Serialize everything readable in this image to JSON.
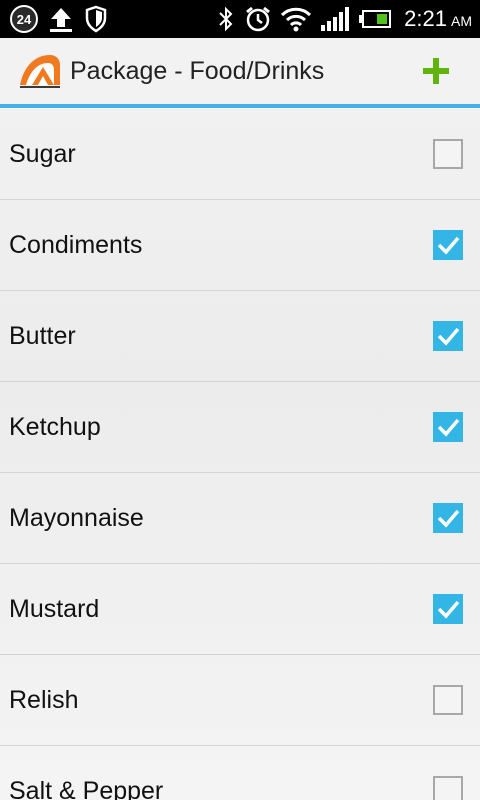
{
  "status_bar": {
    "notification_count": "24",
    "time": "2:21",
    "ampm": "AM",
    "icons": [
      "upload-icon",
      "shield-icon",
      "bluetooth-icon",
      "alarm-icon",
      "wifi-icon",
      "signal-icon",
      "battery-icon"
    ]
  },
  "action_bar": {
    "title": "Package - Food/Drinks",
    "add_icon": "plus-icon",
    "accent_color": "#3fb1e6",
    "add_color": "#5fb40d"
  },
  "checkbox_color": "#33b5e5",
  "items": [
    {
      "label": "Sugar",
      "checked": false
    },
    {
      "label": "Condiments",
      "checked": true
    },
    {
      "label": "Butter",
      "checked": true
    },
    {
      "label": "Ketchup",
      "checked": true
    },
    {
      "label": "Mayonnaise",
      "checked": true
    },
    {
      "label": "Mustard",
      "checked": true
    },
    {
      "label": "Relish",
      "checked": false
    },
    {
      "label": "Salt & Pepper",
      "checked": false
    }
  ]
}
